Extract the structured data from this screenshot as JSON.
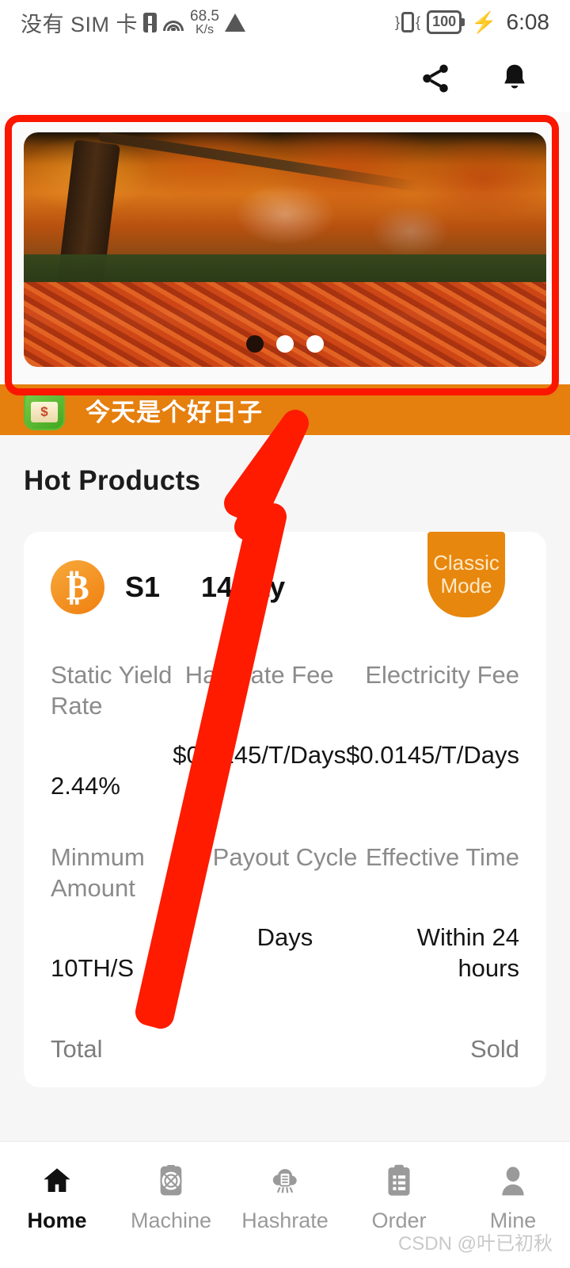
{
  "status_bar": {
    "carrier": "没有 SIM 卡",
    "net_speed_value": "68.5",
    "net_speed_unit": "K/s",
    "battery": "100",
    "time": "6:08",
    "icons": [
      "sim-card-icon",
      "wifi-icon",
      "warning-icon",
      "vibrate-icon",
      "battery-icon",
      "charging-bolt-icon"
    ]
  },
  "app_bar": {
    "share_icon": "share-icon",
    "notification_icon": "bell-icon"
  },
  "banner": {
    "alt": "autumn-foliage-banner",
    "dots": 3,
    "active_dot": 1
  },
  "notice": {
    "icon": "gift-money-icon",
    "text": "今天是个好日子"
  },
  "section": {
    "title": "Hot Products"
  },
  "product": {
    "coin_icon": "bitcoin-icon",
    "name": "S1",
    "duration": "14Day",
    "badge_line1": "Classic",
    "badge_line2": "Mode",
    "specs": [
      {
        "label": "Static Yield Rate",
        "value": "2.44%"
      },
      {
        "label": "Hashrate Fee",
        "value": "$0.0145/T/Days"
      },
      {
        "label": "Electricity Fee",
        "value": "$0.0145/T/Days"
      },
      {
        "label": "Minmum Amount",
        "value": "10TH/S"
      },
      {
        "label": "Payout Cycle",
        "value": "Days"
      },
      {
        "label": "Effective Time",
        "value": "Within 24 hours"
      }
    ],
    "total_label": "Total",
    "sold_label": "Sold"
  },
  "bottom_nav": {
    "items": [
      {
        "label": "Home",
        "icon": "home-icon",
        "active": true
      },
      {
        "label": "Machine",
        "icon": "miner-machine-icon",
        "active": false
      },
      {
        "label": "Hashrate",
        "icon": "hashrate-cloud-icon",
        "active": false
      },
      {
        "label": "Order",
        "icon": "clipboard-order-icon",
        "active": false
      },
      {
        "label": "Mine",
        "icon": "user-profile-icon",
        "active": false
      }
    ]
  },
  "watermark": {
    "text": "CSDN @叶已初秋"
  },
  "annotations": {
    "highlight_color": "#fb1600",
    "arrow_color": "#fe1b00"
  }
}
